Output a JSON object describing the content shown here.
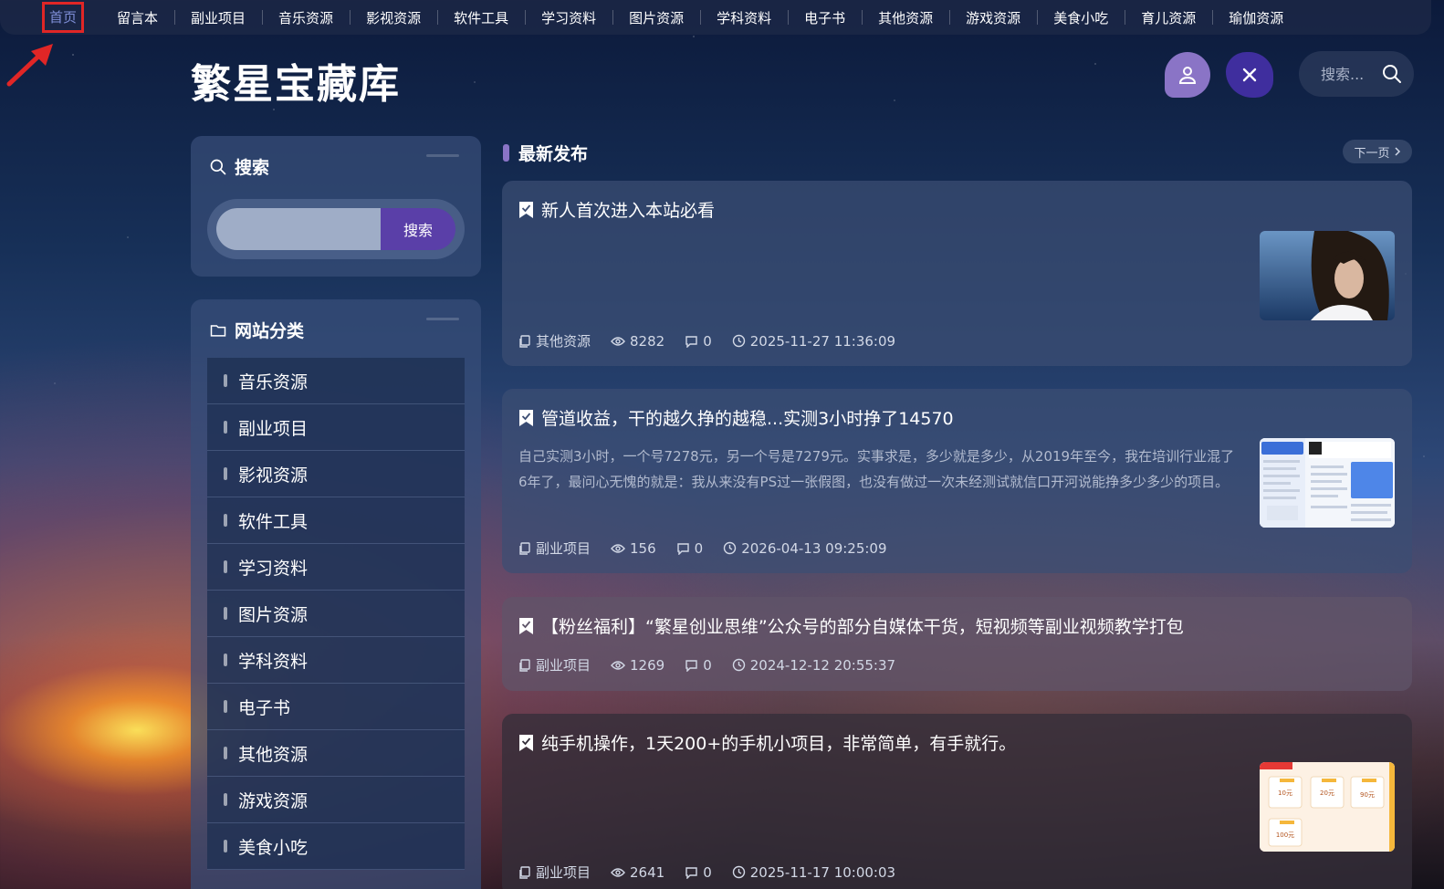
{
  "nav": {
    "home": "首页",
    "items": [
      "留言本",
      "副业项目",
      "音乐资源",
      "影视资源",
      "软件工具",
      "学习资料",
      "图片资源",
      "学科资料",
      "电子书",
      "其他资源",
      "游戏资源",
      "美食小吃",
      "育儿资源",
      "瑜伽资源"
    ]
  },
  "site": {
    "title": "繁星宝藏库"
  },
  "top_search": {
    "placeholder": "搜索..."
  },
  "sidebar": {
    "search": {
      "title": "搜索",
      "button": "搜索"
    },
    "categories": {
      "title": "网站分类",
      "items": [
        "音乐资源",
        "副业项目",
        "影视资源",
        "软件工具",
        "学习资料",
        "图片资源",
        "学科资料",
        "电子书",
        "其他资源",
        "游戏资源",
        "美食小吃"
      ]
    }
  },
  "main": {
    "section_title": "最新发布",
    "next_label": "下一页",
    "posts": [
      {
        "title": "新人首次进入本站必看",
        "desc": "",
        "category": "其他资源",
        "views": "8282",
        "comments": "0",
        "date": "2025-11-27 11:36:09"
      },
      {
        "title": "管道收益，干的越久挣的越稳...实测3小时挣了14570",
        "desc": "自己实测3小时，一个号7278元，另一个号是7279元。实事求是，多少就是多少，从2019年至今，我在培训行业混了6年了，最问心无愧的就是：我从来没有PS过一张假图，也没有做过一次未经测试就信口开河说能挣多少多少的项目。",
        "category": "副业项目",
        "views": "156",
        "comments": "0",
        "date": "2026-04-13 09:25:09"
      },
      {
        "title": "【粉丝福利】“繁星创业思维”公众号的部分自媒体干货，短视频等副业视频教学打包",
        "desc": "",
        "category": "副业项目",
        "views": "1269",
        "comments": "0",
        "date": "2024-12-12 20:55:37"
      },
      {
        "title": "纯手机操作，1天200+的手机小项目，非常简单，有手就行。",
        "desc": "",
        "category": "副业项目",
        "views": "2641",
        "comments": "0",
        "date": "2025-11-17 10:00:03"
      }
    ],
    "thumb4_labels": [
      "10元",
      "20元",
      "90元",
      "100元"
    ]
  },
  "colors": {
    "accent": "#8a74c6",
    "button": "#5a3fa8",
    "highlight": "#e02626"
  }
}
